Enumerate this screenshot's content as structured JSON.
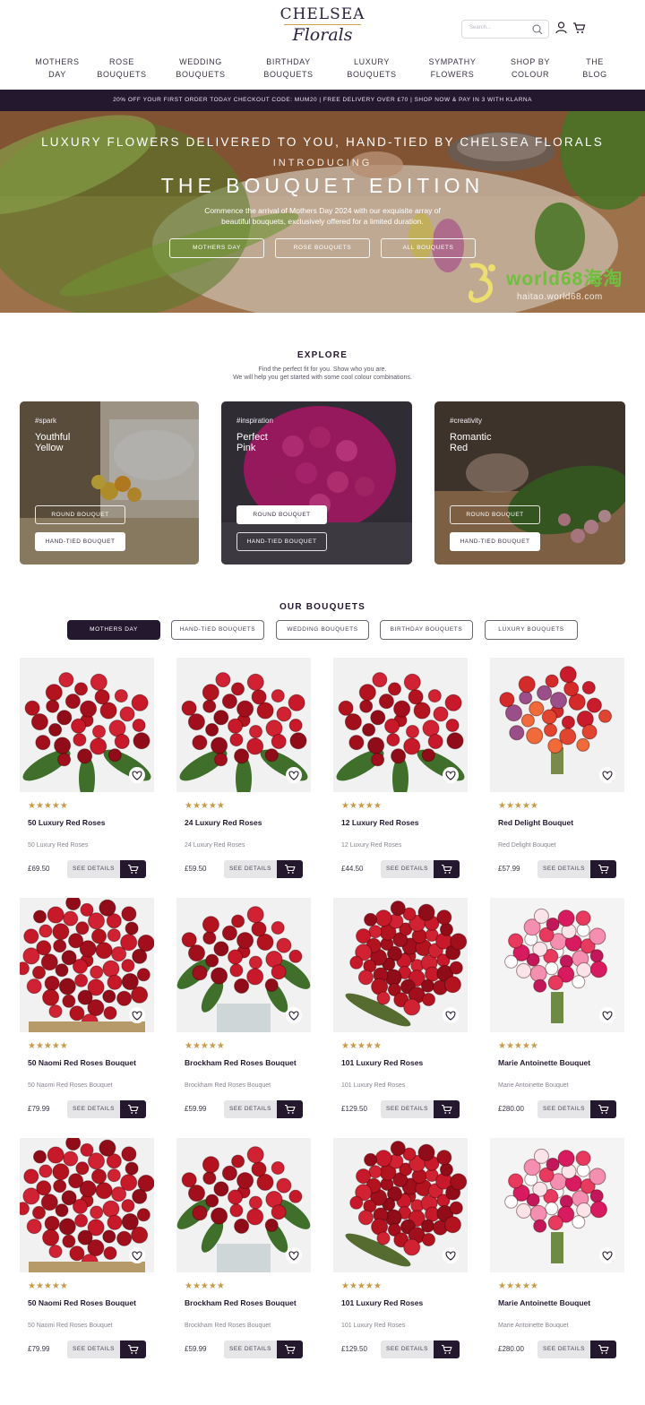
{
  "brand": {
    "name_top": "CHELSEA",
    "name_bottom": "Florals"
  },
  "search": {
    "placeholder": "Search..."
  },
  "nav": {
    "items": [
      {
        "line1": "MOTHERS",
        "line2": "DAY"
      },
      {
        "line1": "ROSE",
        "line2": "BOUQUETS"
      },
      {
        "line1": "WEDDING",
        "line2": "BOUQUETS"
      },
      {
        "line1": "BIRTHDAY",
        "line2": "BOUQUETS"
      },
      {
        "line1": "LUXURY",
        "line2": "BOUQUETS"
      },
      {
        "line1": "SYMPATHY",
        "line2": "FLOWERS"
      },
      {
        "line1": "SHOP BY",
        "line2": "COLOUR"
      },
      {
        "line1": "THE",
        "line2": "BLOG"
      }
    ]
  },
  "promo": {
    "text": "20% OFF YOUR FIRST ORDER TODAY CHECKOUT CODE: MUM20  |  FREE DELIVERY OVER £70  |  SHOP NOW & PAY IN 3 WITH KLARNA"
  },
  "hero": {
    "title1": "LUXURY FLOWERS DELIVERED TO YOU, HAND-TIED BY CHELSEA FLORALS",
    "title2": "INTRODUCING",
    "title3": "THE BOUQUET EDITION",
    "desc_line1": "Commence the arrival of Mothers Day 2024 with our exquisite array of",
    "desc_line2": "beautiful bouquets, exclusively offered for a limited duration.",
    "buttons": [
      "MOTHERS DAY",
      "ROSE BOUQUETS",
      "ALL BOUQUETS"
    ],
    "watermark": "world68海淘",
    "watermark_sub": "haitao.world68.com"
  },
  "explore": {
    "title": "EXPLORE",
    "sub_line1": "Find the perfect fit for you. Show who you are.",
    "sub_line2": "We will help you get started with some cool colour combinations.",
    "cards": [
      {
        "tag": "#spark",
        "line1": "Youthful",
        "line2": "Yellow",
        "btn1": "ROUND BOUQUET",
        "btn2": "HAND-TIED BOUQUET"
      },
      {
        "tag": "#inspiration",
        "line1": "Perfect",
        "line2": "Pink",
        "btn1": "ROUND BOUQUET",
        "btn2": "HAND-TIED BOUQUET"
      },
      {
        "tag": "#creativity",
        "line1": "Romantic",
        "line2": "Red",
        "btn1": "ROUND BOUQUET",
        "btn2": "HAND-TIED BOUQUET"
      }
    ]
  },
  "bouquets": {
    "title": "OUR BOUQUETS",
    "tabs": [
      "MOTHERS DAY",
      "HAND-TIED BOUQUETS",
      "WEDDING BOUQUETS",
      "BIRTHDAY BOUQUETS",
      "LUXURY BOUQUETS"
    ],
    "active_tab": "MOTHERS DAY",
    "details_label": "SEE DETAILS",
    "stars": "★★★★★",
    "rating": 5,
    "products": [
      {
        "name": "50 Luxury Red Roses",
        "sub": "50 Luxury Red Roses",
        "price": "£69.50"
      },
      {
        "name": "24 Luxury Red Roses",
        "sub": "24 Luxury Red Roses",
        "price": "£59.50"
      },
      {
        "name": "12 Luxury Red Roses",
        "sub": "12 Luxury Red Roses",
        "price": "£44.50"
      },
      {
        "name": "Red Delight Bouquet",
        "sub": "Red Delight Bouquet",
        "price": "£57.99"
      },
      {
        "name": "50 Naomi Red Roses Bouquet",
        "sub": "50 Naomi Red Roses Bouquet",
        "price": "£79.99"
      },
      {
        "name": "Brockham Red Roses Bouquet",
        "sub": "Brockham Red Roses Bouquet",
        "price": "£59.99"
      },
      {
        "name": "101 Luxury Red Roses",
        "sub": "101 Luxury Red Roses",
        "price": "£129.50"
      },
      {
        "name": "Marie Antoinette Bouquet",
        "sub": "Marie Antoinette Bouquet",
        "price": "£280.00"
      },
      {
        "name": "50 Naomi Red Roses Bouquet",
        "sub": "50 Naomi Red Roses Bouquet",
        "price": "£79.99"
      },
      {
        "name": "Brockham Red Roses Bouquet",
        "sub": "Brockham Red Roses Bouquet",
        "price": "£59.99"
      },
      {
        "name": "101 Luxury Red Roses",
        "sub": "101 Luxury Red Roses",
        "price": "£129.50"
      },
      {
        "name": "Marie Antoinette Bouquet",
        "sub": "Marie Antoinette Bouquet",
        "price": "£280.00"
      }
    ]
  },
  "colors": {
    "brand_dark": "#24182f",
    "gold": "#c89a4a",
    "rose_red": "#b3121f"
  }
}
